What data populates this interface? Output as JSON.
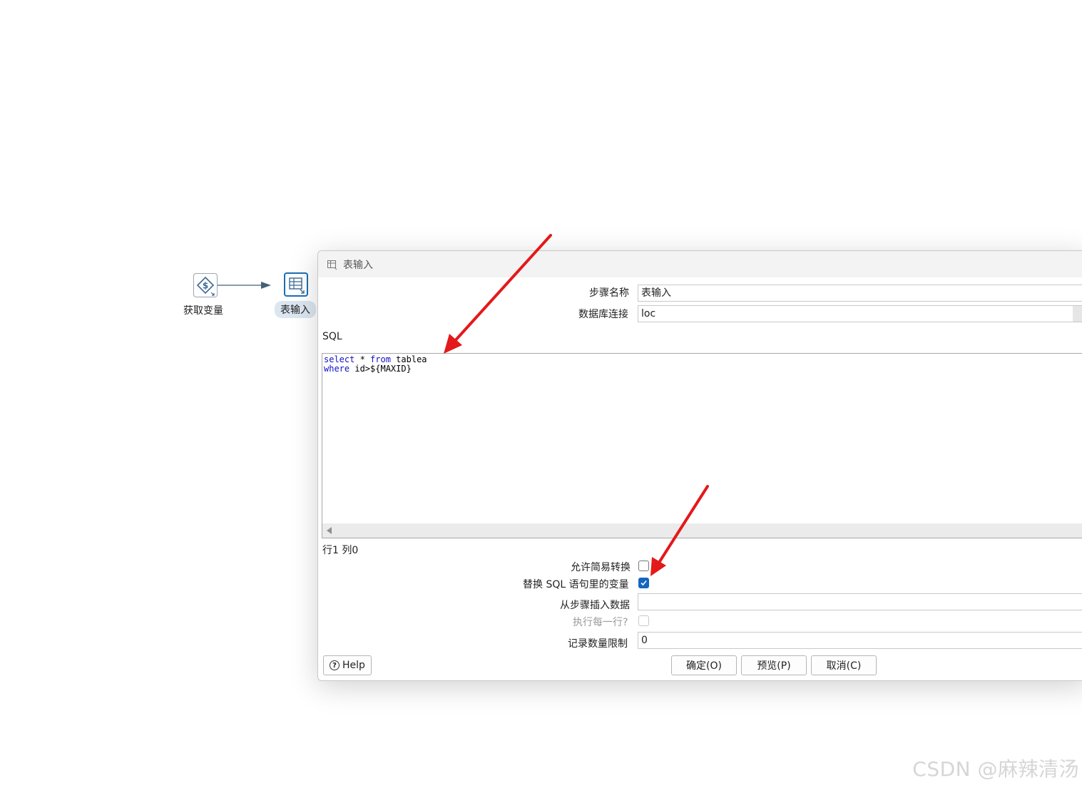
{
  "canvas": {
    "steps": [
      {
        "label": "获取变量",
        "icon": "get-variables-icon"
      },
      {
        "label": "表输入",
        "icon": "table-input-icon"
      }
    ]
  },
  "dialog": {
    "title": "表输入",
    "title_icon": "table-input-icon",
    "step_name_label": "步骤名称",
    "step_name_value": "表输入",
    "db_connection_label": "数据库连接",
    "db_connection_value": "loc",
    "sql_label": "SQL",
    "sql_lines": [
      [
        {
          "text": "select",
          "kw": true
        },
        {
          "text": " * ",
          "kw": false
        },
        {
          "text": "from",
          "kw": true
        },
        {
          "text": " tablea",
          "kw": false
        }
      ],
      [
        {
          "text": "where",
          "kw": true
        },
        {
          "text": " id>${MAXID}",
          "kw": false
        }
      ]
    ],
    "cursor_position": "行1 列0",
    "allow_lazy_conversion_label": "允许简易转换",
    "allow_lazy_conversion_checked": false,
    "replace_variables_label": "替换 SQL 语句里的变量",
    "replace_variables_checked": true,
    "insert_from_step_label": "从步骤插入数据",
    "insert_from_step_value": "",
    "execute_each_row_label": "执行每一行?",
    "execute_each_row_checked": false,
    "limit_label": "记录数量限制",
    "limit_value": "0",
    "help_label": "Help",
    "ok_label": "确定(O)",
    "preview_label": "预览(P)",
    "cancel_label": "取消(C)"
  },
  "watermark": "CSDN @麻辣清汤",
  "colors": {
    "annotation_arrow": "#e3191b",
    "keyword": "#1010c8",
    "accent": "#1565c0"
  }
}
